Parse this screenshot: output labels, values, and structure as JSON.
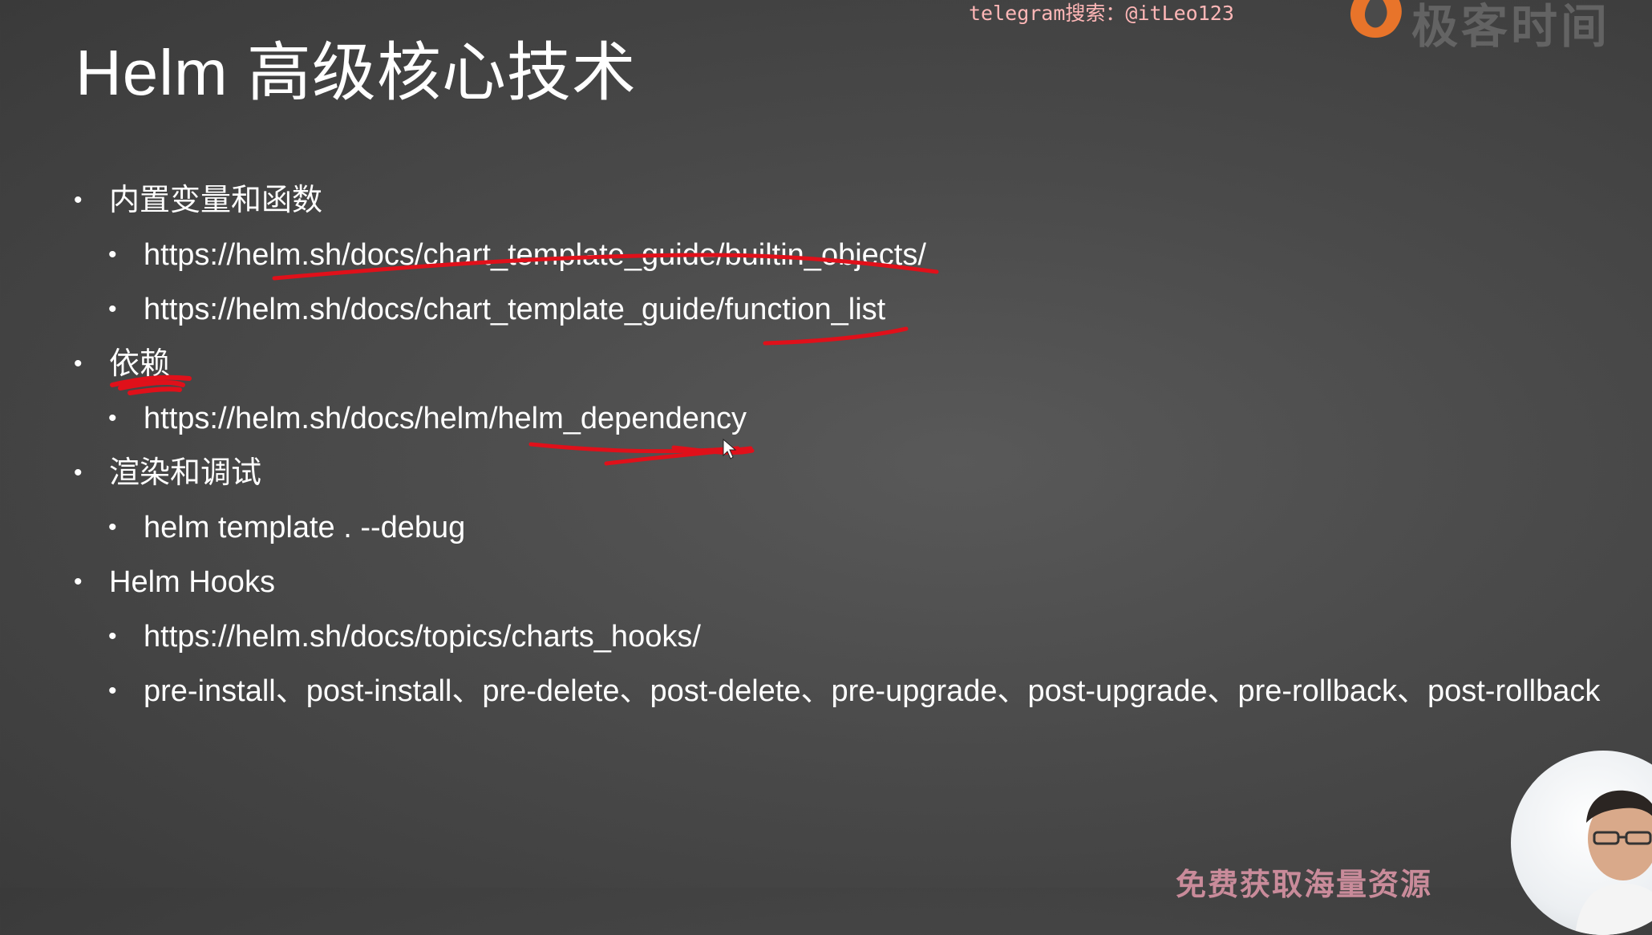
{
  "title": "Helm 高级核心技术",
  "watermark": "telegram搜索：@itLeo123",
  "logo": {
    "icon": "flame-logo-icon",
    "text": "极客时间",
    "brand_color": "#e8742a"
  },
  "sections": [
    {
      "label": "内置变量和函数",
      "items": [
        "https://helm.sh/docs/chart_template_guide/builtin_objects/",
        "https://helm.sh/docs/chart_template_guide/function_list"
      ]
    },
    {
      "label": "依赖",
      "items": [
        "https://helm.sh/docs/helm/helm_dependency"
      ]
    },
    {
      "label": "渲染和调试",
      "items": [
        "helm template . --debug"
      ]
    },
    {
      "label": "Helm Hooks",
      "items": [
        "https://helm.sh/docs/topics/charts_hooks/",
        "pre-install、post-install、pre-delete、post-delete、pre-upgrade、post-upgrade、pre-rollback、post-rollback"
      ]
    }
  ],
  "promo_text": "免费获取海量资源",
  "colors": {
    "background": "#4a4a4a",
    "text": "#ffffff",
    "annotation": "#e0101a",
    "watermark": "#ffb7b7",
    "promo": "#c98b9a"
  },
  "annotation_icon": "red-pen-underline-icon",
  "cursor_icon": "mouse-pointer-icon",
  "webcam_icon": "presenter-webcam-icon"
}
